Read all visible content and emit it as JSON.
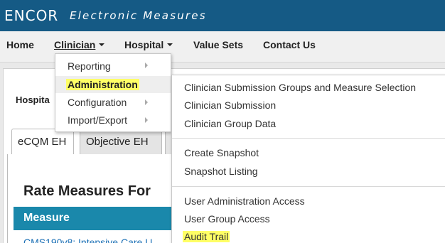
{
  "header": {
    "logo": "ENCOR",
    "subtitle": "Electronic Measures"
  },
  "nav": {
    "home": "Home",
    "clinician": "Clinician",
    "hospital": "Hospital",
    "value_sets": "Value Sets",
    "contact_us": "Contact Us"
  },
  "page": {
    "hospital_label": "Hospita",
    "tabs": [
      {
        "label": "eCQM EH"
      },
      {
        "label": "Objective EH"
      }
    ],
    "section_title": "Rate Measures For",
    "table_header": "Measure",
    "row_text": "CMS190v8: Intensive Care U"
  },
  "clinician_menu": {
    "items": [
      {
        "label": "Reporting"
      },
      {
        "label": "Administration"
      },
      {
        "label": "Configuration"
      },
      {
        "label": "Import/Export"
      }
    ]
  },
  "administration_menu": {
    "group1": [
      {
        "label": "Clinician Submission Groups and Measure Selection"
      },
      {
        "label": "Clinician Submission"
      },
      {
        "label": "Clinician Group Data"
      }
    ],
    "group2": [
      {
        "label": "Create Snapshot"
      },
      {
        "label": "Snapshot Listing"
      }
    ],
    "group3": [
      {
        "label": "User Administration Access"
      },
      {
        "label": "User Group Access"
      },
      {
        "label": "Audit Trail"
      }
    ]
  },
  "colors": {
    "topbar": "#155a85",
    "table_header": "#1a88ab",
    "highlight": "#ffff66",
    "link": "#1a6fb5"
  }
}
